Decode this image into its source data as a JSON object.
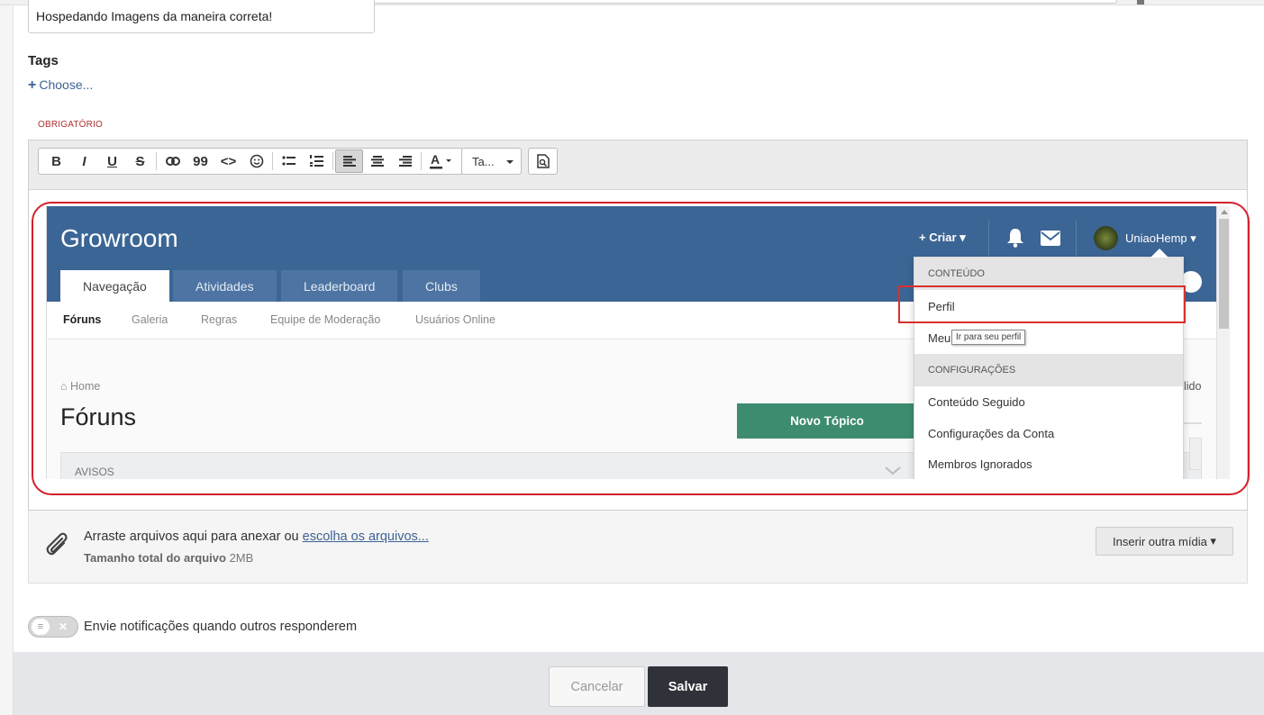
{
  "topic_title": "Hospedando Imagens da maneira correta!",
  "tags": {
    "label": "Tags",
    "choose": "Choose..."
  },
  "required_label": "OBRIGATÓRIO",
  "toolbar": {
    "bold": "B",
    "italic": "I",
    "underline": "U",
    "strike": "S",
    "quote": "99",
    "code": "<>",
    "font_select": "Ta..."
  },
  "embedded": {
    "logo": "Growroom",
    "criar": "Criar",
    "username": "UniaoHemp",
    "tabs": [
      "Navegação",
      "Atividades",
      "Leaderboard",
      "Clubs"
    ],
    "subnav": [
      "Fóruns",
      "Galeria",
      "Regras",
      "Equipe de Moderação",
      "Usuários Online"
    ],
    "breadcrumb": "Home",
    "page_title": "Fóruns",
    "new_topic": "Novo Tópico",
    "section": "AVISOS",
    "partial_right": "lido",
    "menu": {
      "head_content": "CONTEÚDO",
      "perfil": "Perfil",
      "meu": "Meu",
      "tooltip": "Ir para seu perfil",
      "head_settings": "CONFIGURAÇÕES",
      "followed": "Conteúdo Seguido",
      "account": "Configurações da Conta",
      "ignored": "Membros Ignorados"
    }
  },
  "attach": {
    "text": "Arraste arquivos aqui para anexar ou",
    "link": "escolha os arquivos...",
    "size_label": "Tamanho total do arquivo",
    "size_value": "2MB",
    "other_media": "Inserir outra mídia"
  },
  "notify_label": "Envie notificações quando outros responderem",
  "buttons": {
    "cancel": "Cancelar",
    "save": "Salvar"
  },
  "colors": {
    "header_blue": "#3b6595",
    "green": "#3e8c6f",
    "highlight_red": "#d4202a",
    "dark_button": "#2f3239"
  }
}
